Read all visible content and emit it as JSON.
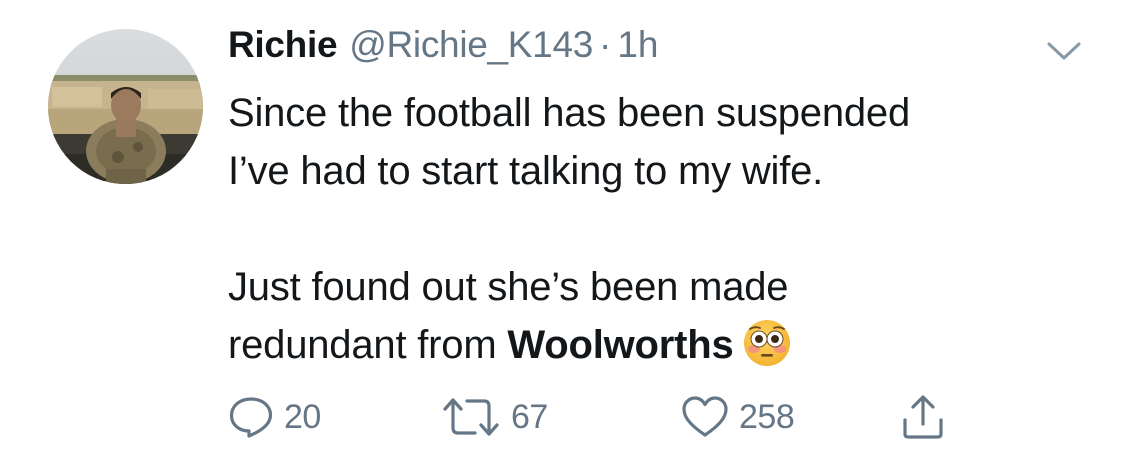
{
  "author": {
    "display_name": "Richie",
    "handle": "@Richie_K143",
    "separator": "·",
    "time": "1h"
  },
  "tweet": {
    "line1": "Since the football has been suspended",
    "line2": "I’ve had to start talking to my wife.",
    "line3": "Just found out she’s been made",
    "line4_prefix": "redundant from ",
    "line4_bold": "Woolworths",
    "emoji": "flushed-face"
  },
  "actions": {
    "reply_count": "20",
    "retweet_count": "67",
    "like_count": "258"
  },
  "icons": {
    "menu": "chevron-down-icon",
    "reply": "reply-icon",
    "retweet": "retweet-icon",
    "like": "heart-icon",
    "share": "share-icon"
  },
  "colors": {
    "text": "#14171a",
    "secondary": "#657786",
    "background": "#ffffff"
  }
}
